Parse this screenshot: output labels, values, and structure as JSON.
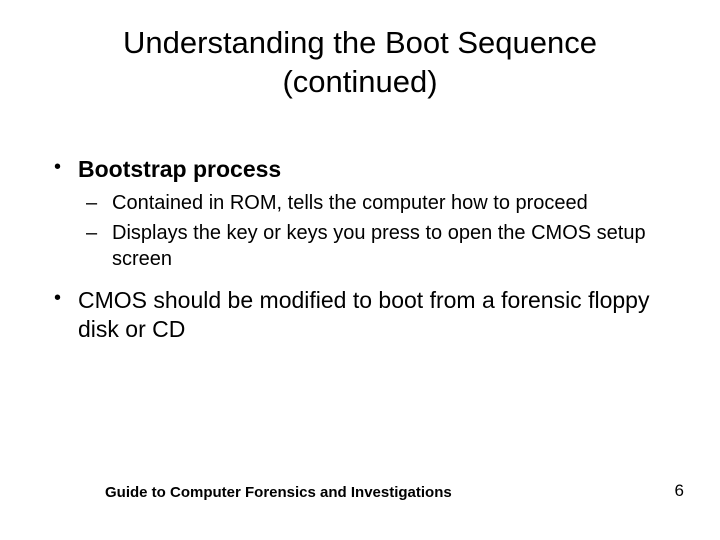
{
  "title_line1": "Understanding the Boot Sequence",
  "title_line2": "(continued)",
  "bullets": {
    "b1_label": "Bootstrap process",
    "b1_sub1": "Contained in ROM, tells the computer how to proceed",
    "b1_sub2": "Displays the key or keys you press to open the CMOS setup screen",
    "b2_label": "CMOS should be modified to boot from a forensic floppy disk or CD"
  },
  "footer": {
    "left": "Guide to Computer Forensics and Investigations",
    "right": "6"
  }
}
